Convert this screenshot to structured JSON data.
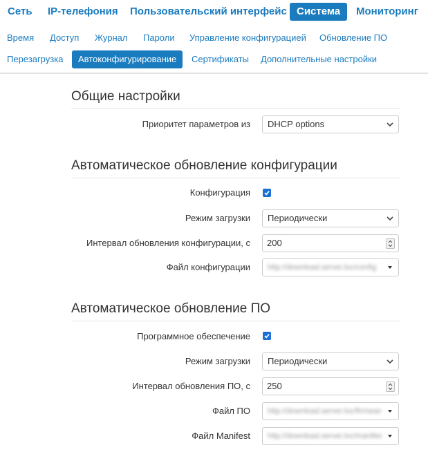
{
  "top_nav": [
    {
      "label": "Сеть"
    },
    {
      "label": "IP-телефония"
    },
    {
      "label": "Пользовательский интерфейс"
    },
    {
      "label": "Система",
      "active": true
    },
    {
      "label": "Мониторинг"
    }
  ],
  "sub_nav": [
    {
      "label": "Время"
    },
    {
      "label": "Доступ"
    },
    {
      "label": "Журнал"
    },
    {
      "label": "Пароли"
    },
    {
      "label": "Управление конфигурацией"
    },
    {
      "label": "Обновление ПО"
    },
    {
      "label": "Перезагрузка"
    },
    {
      "label": "Автоконфигурирование",
      "active": true
    },
    {
      "label": "Сертификаты"
    },
    {
      "label": "Дополнительные настройки"
    }
  ],
  "general": {
    "title": "Общие настройки",
    "priority_label": "Приоритет параметров из",
    "priority_value": "DHCP options"
  },
  "config_update": {
    "title": "Автоматическое обновление конфигурации",
    "enable_label": "Конфигурация",
    "enabled": true,
    "mode_label": "Режим загрузки",
    "mode_value": "Периодически",
    "interval_label": "Интервал обновления конфигурации, с",
    "interval_value": "200",
    "file_label": "Файл конфигурации",
    "file_value": "http://download.server.loc/config"
  },
  "fw_update": {
    "title": "Автоматическое обновление ПО",
    "enable_label": "Программное обеспечение",
    "enabled": true,
    "mode_label": "Режим загрузки",
    "mode_value": "Периодически",
    "interval_label": "Интервал обновления ПО, с",
    "interval_value": "250",
    "file_label": "Файл ПО",
    "file_value": "http://download.server.loc/firmware",
    "manifest_label": "Файл Manifest",
    "manifest_value": "http://download.server.loc/manifest"
  },
  "colors": {
    "accent": "#1a7bbf",
    "checkbox": "#1a6fd6",
    "text": "#333333",
    "border": "#cccccc"
  }
}
